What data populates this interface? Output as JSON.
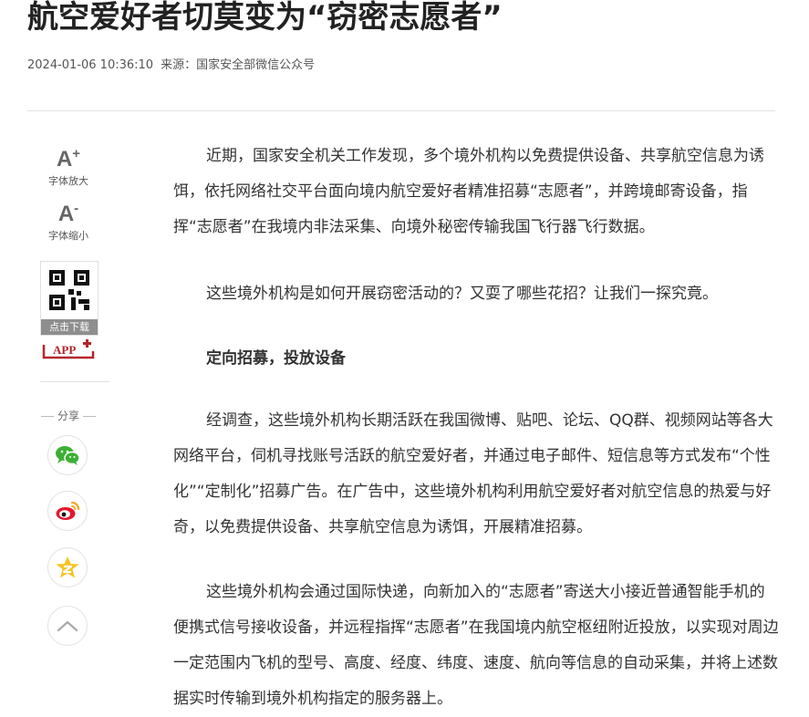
{
  "article": {
    "title": "航空爱好者切莫变为“窃密志愿者”",
    "datetime": "2024-01-06 10:36:10",
    "source": "来源：国家安全部微信公众号",
    "paragraphs": [
      "近期，国家安全机关工作发现，多个境外机构以免费提供设备、共享航空信息为诱饵，依托网络社交平台面向境内航空爱好者精准招募“志愿者”，并跨境邮寄设备，指挥“志愿者”在我境内非法采集、向境外秘密传输我国飞行器飞行数据。",
      "这些境外机构是如何开展窃密活动的？又耍了哪些花招？让我们一探究竟。",
      "经调查，这些境外机构长期活跃在我国微博、贴吧、论坛、QQ群、视频网站等各大网络平台，伺机寻找账号活跃的航空爱好者，并通过电子邮件、短信息等方式发布“个性化”“定制化”招募广告。在广告中，这些境外机构利用航空爱好者对航空信息的热爱与好奇，以免费提供设备、共享航空信息为诱饵，开展精准招募。",
      "这些境外机构会通过国际快递，向新加入的“志愿者”寄送大小接近普通智能手机的便携式信号接收设备，并远程指挥“志愿者”在我国境内航空枢纽附近投放，以实现对周边一定范围内飞机的型号、高度、经度、纬度、速度、航向等信息的自动采集，并将上述数据实时传输到境外机构指定的服务器上。"
    ],
    "subheading": "定向招募，投放设备"
  },
  "sidebar": {
    "font_increase_glyph": "A",
    "font_increase_sign": "+",
    "font_increase_label": "字体放大",
    "font_decrease_glyph": "A",
    "font_decrease_sign": "-",
    "font_decrease_label": "字体缩小",
    "qr_label": "点击下载",
    "app_label": "APP",
    "share_label": "分享",
    "icons": {
      "font_increase": "font-increase-icon",
      "font_decrease": "font-decrease-icon",
      "qr": "qr-code-icon",
      "wechat": "wechat-icon",
      "weibo": "weibo-icon",
      "qzone": "qzone-icon",
      "back_top": "chevron-up-icon"
    }
  },
  "colors": {
    "app_red": "#b5252b",
    "wechat_green": "#3cb034",
    "weibo_red": "#e6162d",
    "weibo_orange": "#f5a623",
    "qzone_yellow": "#f7c325"
  }
}
